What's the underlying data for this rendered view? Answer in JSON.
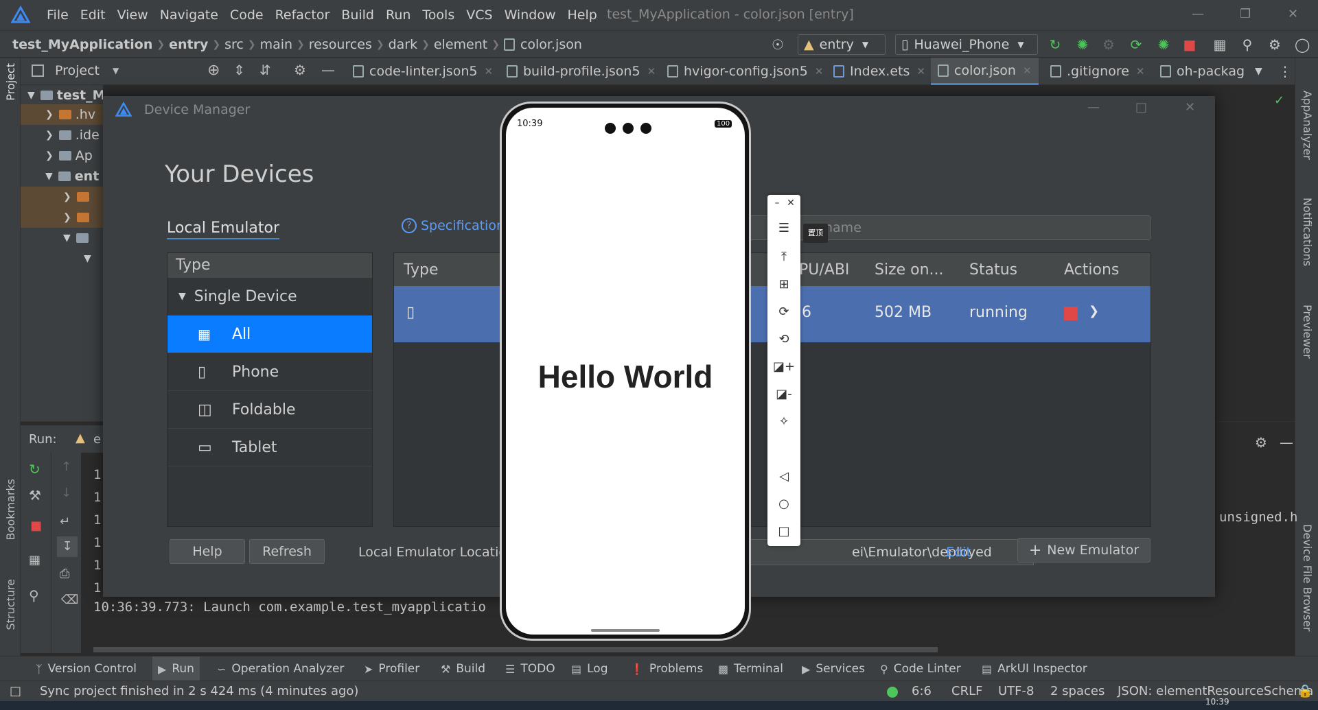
{
  "window": {
    "title": "test_MyApplication - color.json [entry]",
    "menu": [
      "File",
      "Edit",
      "View",
      "Navigate",
      "Code",
      "Refactor",
      "Build",
      "Run",
      "Tools",
      "VCS",
      "Window",
      "Help"
    ]
  },
  "breadcrumb": [
    "test_MyApplication",
    "entry",
    "src",
    "main",
    "resources",
    "dark",
    "element",
    "color.json"
  ],
  "toolbar": {
    "module": "entry",
    "device": "Huawei_Phone"
  },
  "project_panel": {
    "label": "Project"
  },
  "editor_tabs": [
    {
      "label": "code-linter.json5"
    },
    {
      "label": "build-profile.json5"
    },
    {
      "label": "hvigor-config.json5"
    },
    {
      "label": "Index.ets"
    },
    {
      "label": "color.json"
    },
    {
      "label": ".gitignore"
    },
    {
      "label": "oh-packag"
    }
  ],
  "tree": {
    "root": "test_M",
    "items": [
      ".hv",
      ".ide",
      "Ap",
      "ent"
    ]
  },
  "left_stripe": [
    "Project",
    "Bookmarks",
    "Structure"
  ],
  "right_stripe": [
    "AppAnalyzer",
    "Notifications",
    "Previewer",
    "Device File Browser"
  ],
  "run": {
    "label": "Run:",
    "config": "e",
    "lines": [
      "1",
      "1",
      "1",
      "1",
      "1",
      "1"
    ],
    "log": "10:36:39.773: Launch com.example.test_myapplicatio",
    "right_text": "unsigned.h"
  },
  "device_manager": {
    "title": "Device Manager",
    "heading": "Your Devices",
    "tab": "Local Emulator",
    "spec_link": "Specifications",
    "search_placeholder": "name",
    "type_header": "Type",
    "group": "Single Device",
    "types": [
      "All",
      "Phone",
      "Foldable",
      "Tablet"
    ],
    "columns": [
      "Type",
      "PU/ABI",
      "Size on...",
      "Status",
      "Actions"
    ],
    "row": {
      "abi": "6",
      "size": "502 MB",
      "status": "running"
    },
    "help_btn": "Help",
    "refresh_btn": "Refresh",
    "location_label": "Local Emulator Location",
    "location_value": "ei\\Emulator\\deployed",
    "edit_link": "Edit",
    "new_emulator_btn": "New Emulator"
  },
  "phone": {
    "time": "10:39",
    "battery": "100",
    "content": "Hello World"
  },
  "emulator_tooltip": "置顶",
  "tool_tabs": [
    "Version Control",
    "Run",
    "Operation Analyzer",
    "Profiler",
    "Build",
    "TODO",
    "Log",
    "Problems",
    "Terminal",
    "Services",
    "Code Linter",
    "ArkUI Inspector"
  ],
  "status": {
    "message": "Sync project finished in 2 s 424 ms (4 minutes ago)",
    "position": "6:6",
    "line_sep": "CRLF",
    "encoding": "UTF-8",
    "indent": "2 spaces",
    "schema": "JSON: elementResourceSchema",
    "clock": "10:39"
  }
}
